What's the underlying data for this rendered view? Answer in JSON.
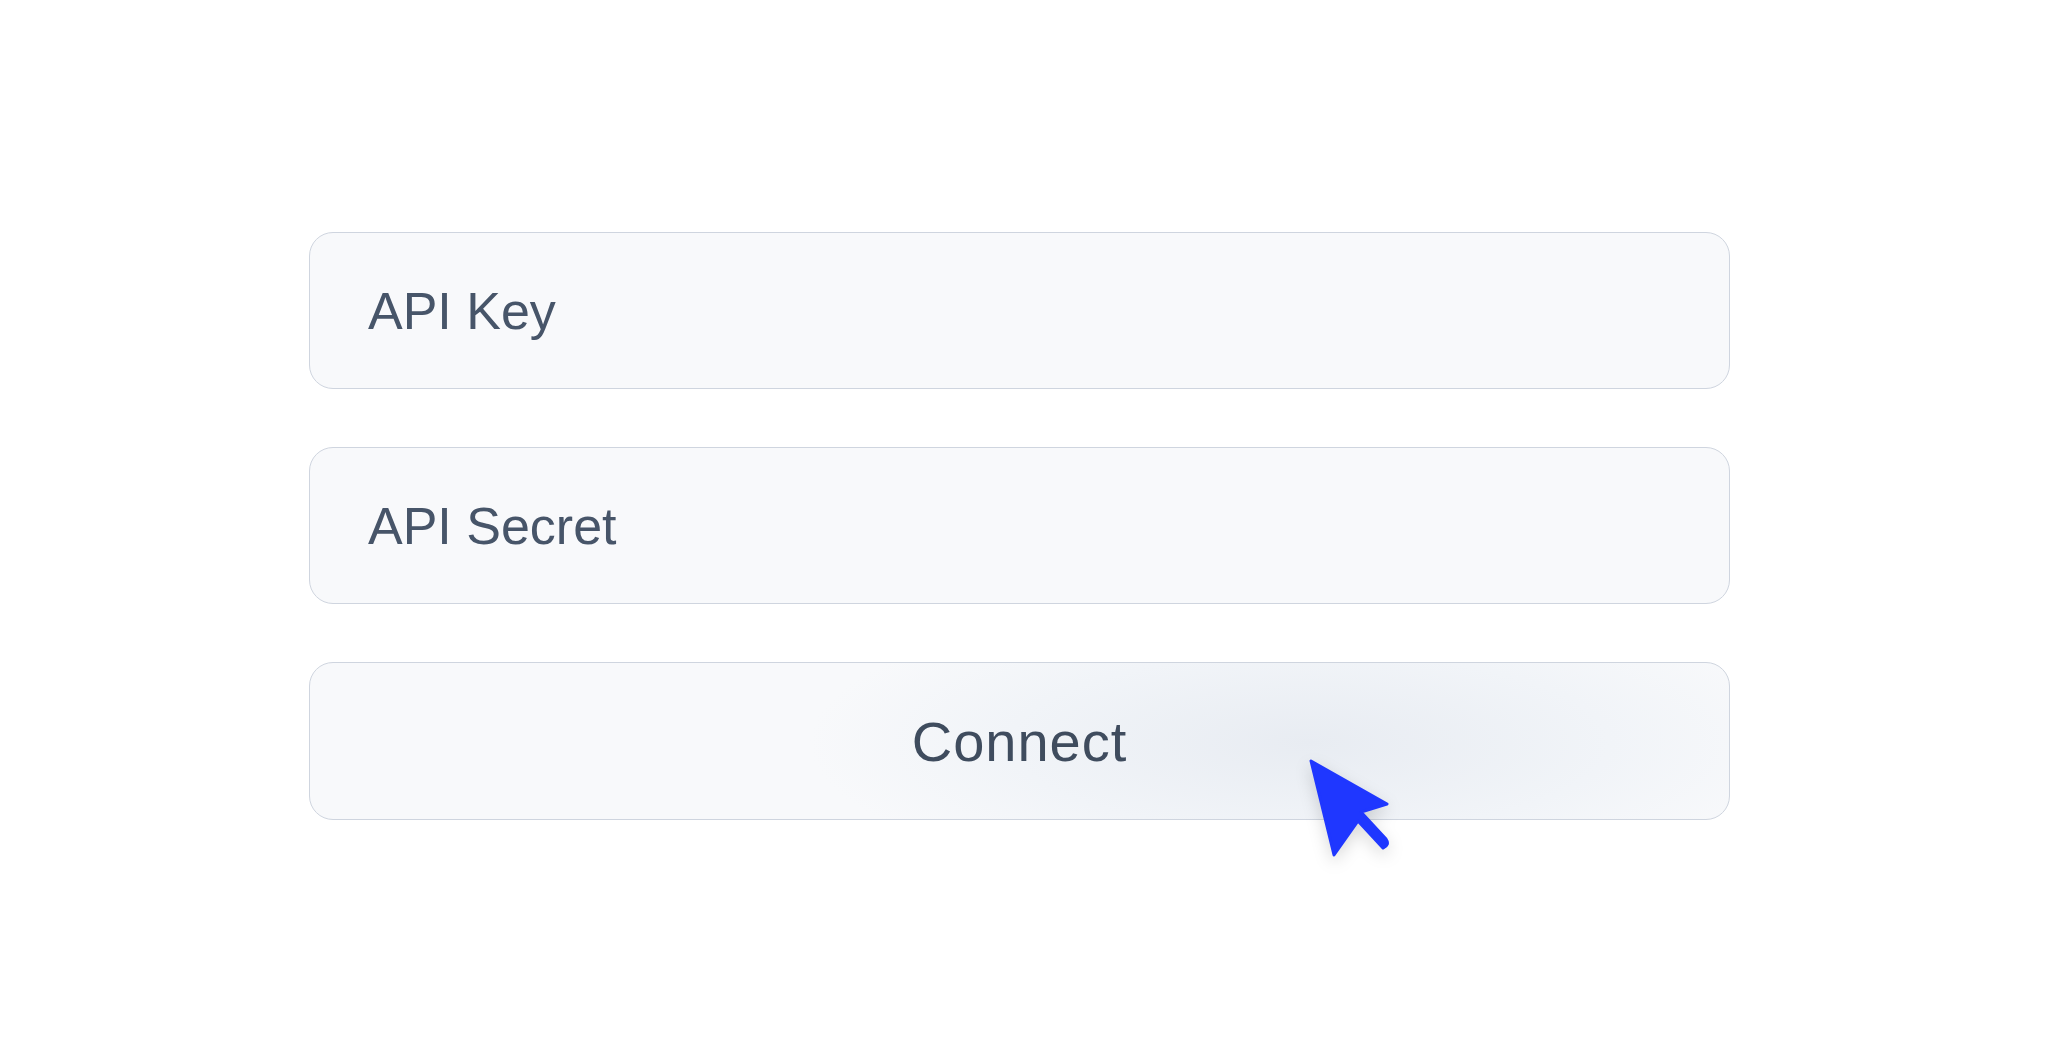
{
  "fields": [
    {
      "placeholder": "API Key"
    },
    {
      "placeholder": "API Secret"
    }
  ],
  "button": {
    "label": "Connect"
  }
}
